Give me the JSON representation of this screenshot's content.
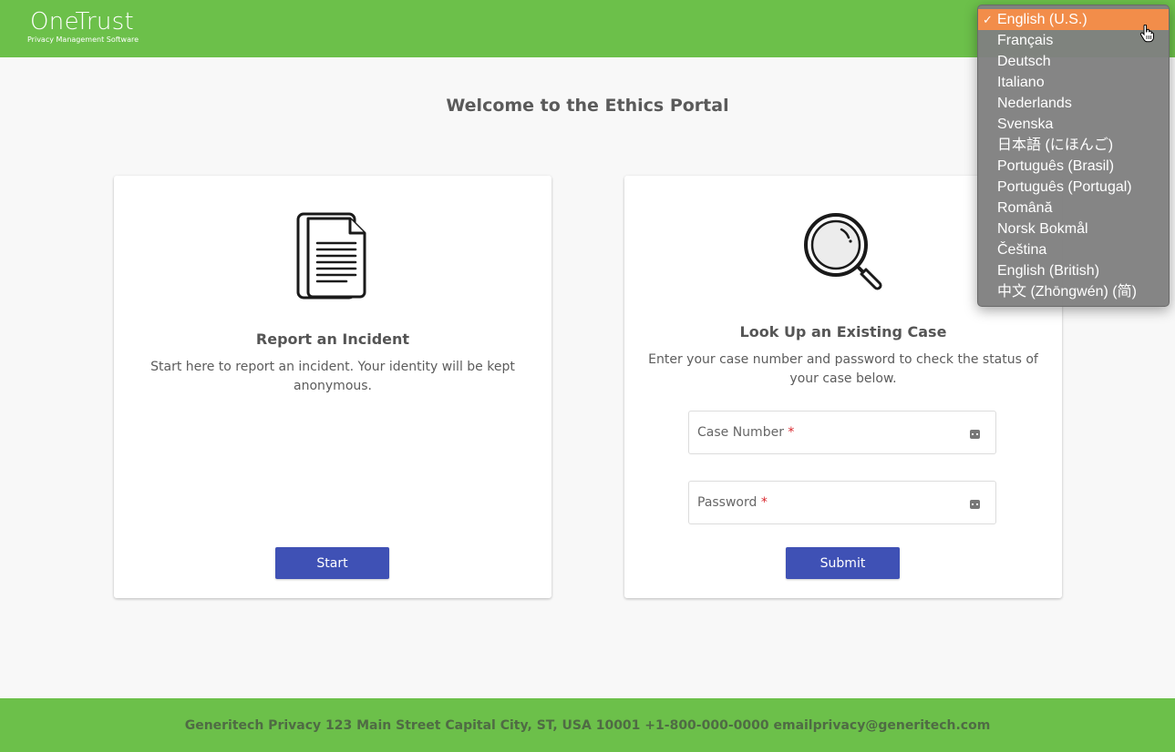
{
  "header": {
    "logo_name": "OneTrust",
    "logo_tagline": "Privacy Management Software",
    "brand_color": "#6cc04a"
  },
  "page_title": "Welcome to the Ethics Portal",
  "report_card": {
    "icon": "documents-icon",
    "title": "Report an Incident",
    "description": "Start here to report an incident. Your identity will be kept anonymous.",
    "button_label": "Start"
  },
  "lookup_card": {
    "icon": "magnifier-icon",
    "title": "Look Up an Existing Case",
    "description": "Enter your case number and password to check the status of your case below.",
    "case_number_label": "Case Number",
    "case_number_value": "",
    "password_label": "Password",
    "password_value": "",
    "required_marker": "*",
    "button_label": "Submit"
  },
  "accent_color": "#3f51b5",
  "footer": {
    "text": "Generitech Privacy 123 Main Street Capital City, ST, USA 10001 +1-800-000-0000 emailprivacy@generitech.com"
  },
  "language_menu": {
    "selected_index": 0,
    "selected_marker": "✓",
    "highlight_color": "#f28d4a",
    "options": [
      "English (U.S.)",
      "Français",
      "Deutsch",
      "Italiano",
      "Nederlands",
      "Svenska",
      "日本語 (にほんご)",
      "Português (Brasil)",
      "Português (Portugal)",
      "Română",
      "Norsk Bokmål",
      "Čeština",
      "English (British)",
      "中文 (Zhōngwén) (简)"
    ]
  }
}
